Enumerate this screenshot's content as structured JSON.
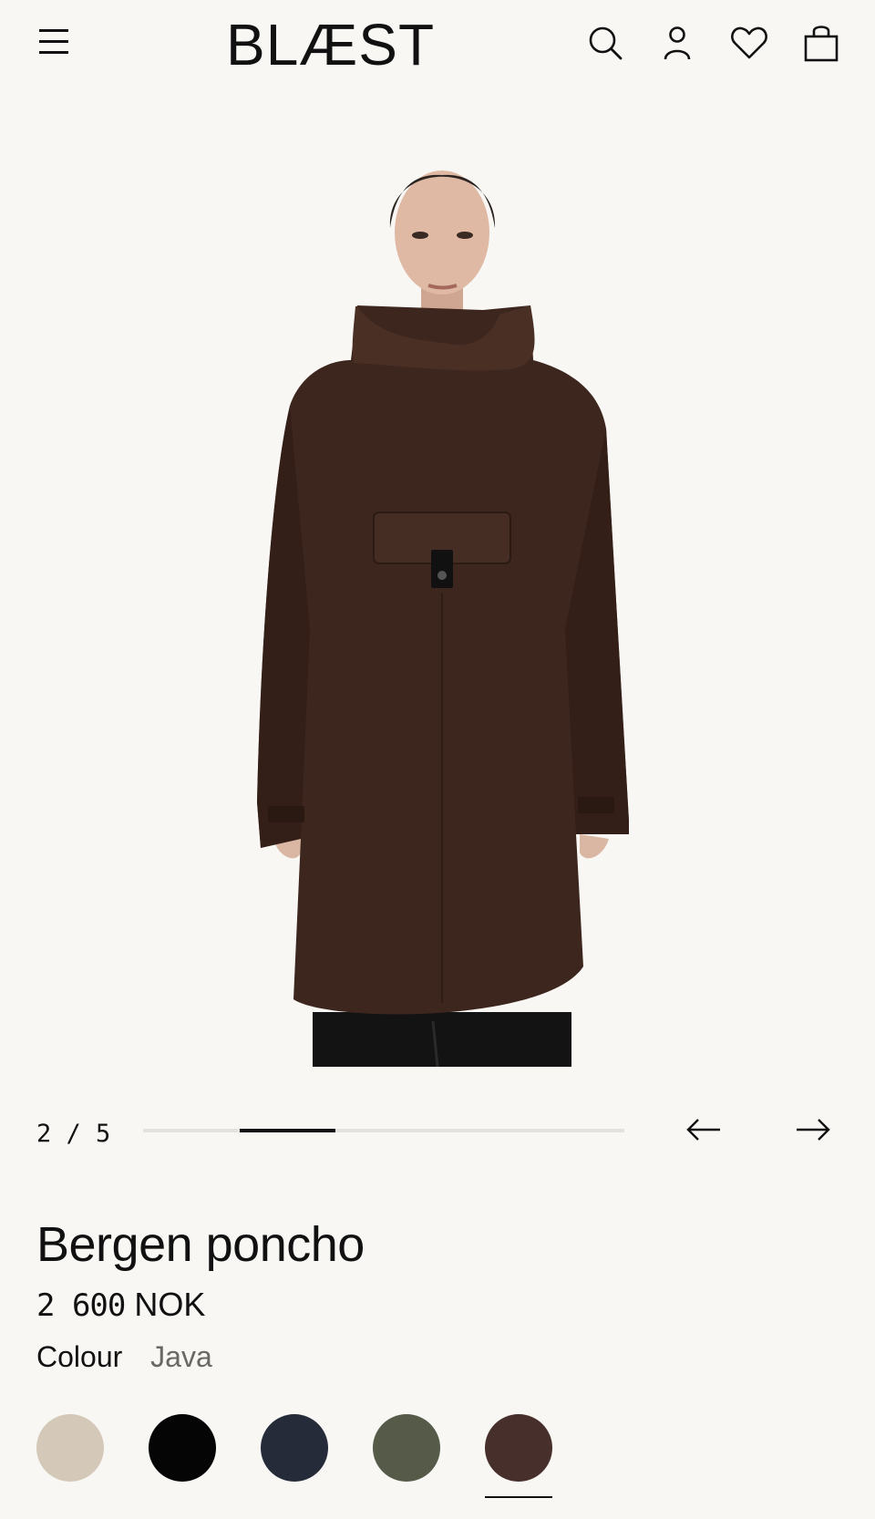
{
  "header": {
    "logo": "BLÆST",
    "icons": [
      "menu-icon",
      "search-icon",
      "account-icon",
      "wishlist-icon",
      "bag-icon"
    ]
  },
  "gallery": {
    "counter": "2 / 5",
    "current": 2,
    "total": 5
  },
  "product": {
    "title": "Bergen poncho",
    "price_amount": "2 600",
    "price_currency": "NOK",
    "colour_label": "Colour",
    "colour_value": "Java"
  },
  "swatches": [
    {
      "color": "#d4c9b8",
      "selected": false
    },
    {
      "color": "#050505",
      "selected": false
    },
    {
      "color": "#262b3a",
      "selected": false
    },
    {
      "color": "#555b48",
      "selected": false
    },
    {
      "color": "#47302b",
      "selected": true
    }
  ],
  "colors": {
    "background": "#f8f7f4",
    "poncho": "#3d261e",
    "text": "#111111",
    "muted": "#6b6863"
  }
}
